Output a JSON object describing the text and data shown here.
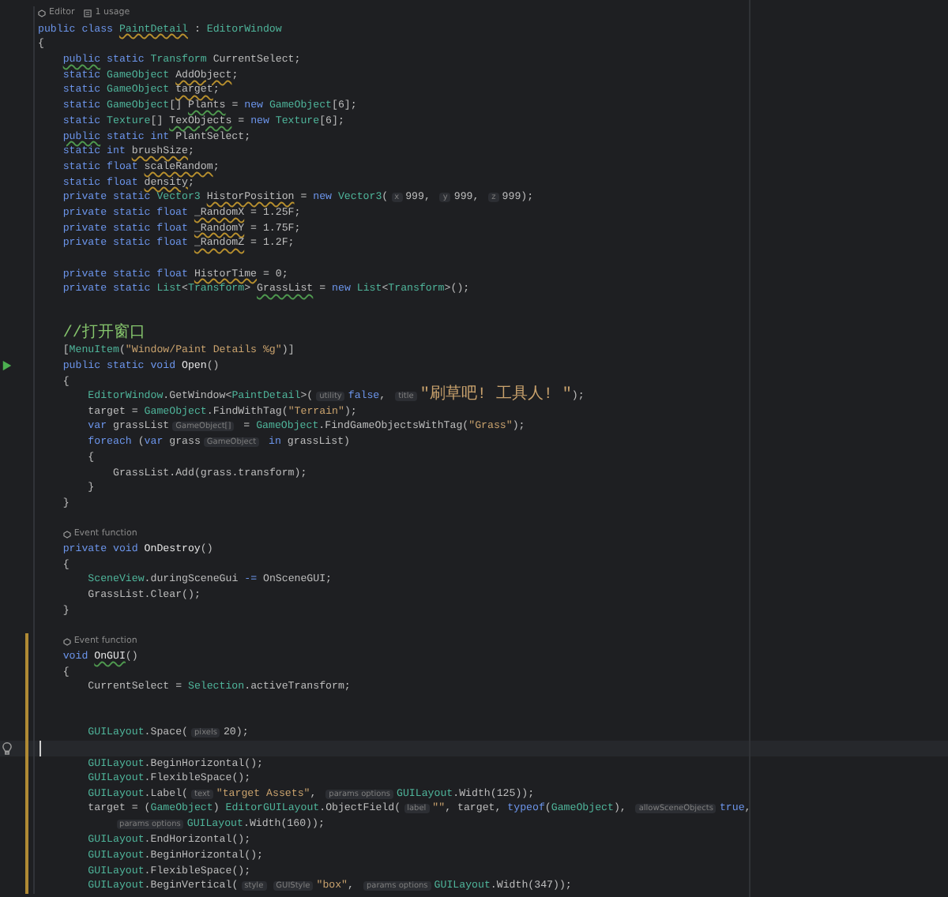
{
  "lines": [
    {
      "kind": "lens",
      "current": false,
      "modified": false,
      "items": [
        {
          "text": "Editor"
        },
        {
          "text": "1 usage"
        }
      ]
    },
    {
      "kind": "code",
      "current": false,
      "modified": false,
      "tokens": [
        {
          "kind": "kw",
          "text": "public class "
        },
        {
          "kind": "warntype",
          "text": "PaintDetail"
        },
        {
          "kind": "plain",
          "text": " : "
        },
        {
          "kind": "type",
          "text": "EditorWindow"
        }
      ]
    },
    {
      "kind": "code",
      "current": false,
      "modified": false,
      "tokens": [
        {
          "kind": "plain",
          "text": "{"
        }
      ],
      "children": [
        {
          "kind": "code",
          "current": false,
          "modified": false,
          "tokens": [
            {
              "kind": "suggkw",
              "text": "public"
            },
            {
              "kind": "kw",
              "text": " static "
            },
            {
              "kind": "type",
              "text": "Transform"
            },
            {
              "kind": "plain",
              "text": " CurrentSelect;"
            }
          ]
        },
        {
          "kind": "code",
          "current": false,
          "modified": false,
          "tokens": [
            {
              "kind": "kw",
              "text": "static "
            },
            {
              "kind": "type",
              "text": "GameObject "
            },
            {
              "kind": "warn",
              "text": "AddObject"
            },
            {
              "kind": "plain",
              "text": ";"
            }
          ]
        },
        {
          "kind": "code",
          "current": false,
          "modified": false,
          "tokens": [
            {
              "kind": "kw",
              "text": "static "
            },
            {
              "kind": "type",
              "text": "GameObject "
            },
            {
              "kind": "warn",
              "text": "target"
            },
            {
              "kind": "plain",
              "text": ";"
            }
          ]
        },
        {
          "kind": "code",
          "current": false,
          "modified": false,
          "tokens": [
            {
              "kind": "kw",
              "text": "static "
            },
            {
              "kind": "type",
              "text": "GameObject"
            },
            {
              "kind": "plain",
              "text": "[] "
            },
            {
              "kind": "sugg",
              "text": "Plants"
            },
            {
              "kind": "plain",
              "text": " = "
            },
            {
              "kind": "kw",
              "text": "new "
            },
            {
              "kind": "type",
              "text": "GameObject"
            },
            {
              "kind": "plain",
              "text": "[6];"
            }
          ]
        },
        {
          "kind": "code",
          "current": false,
          "modified": false,
          "tokens": [
            {
              "kind": "kw",
              "text": "static "
            },
            {
              "kind": "type",
              "text": "Texture"
            },
            {
              "kind": "plain",
              "text": "[] "
            },
            {
              "kind": "sugg",
              "text": "TexObjects"
            },
            {
              "kind": "plain",
              "text": " = "
            },
            {
              "kind": "kw",
              "text": "new "
            },
            {
              "kind": "type",
              "text": "Texture"
            },
            {
              "kind": "plain",
              "text": "[6];"
            }
          ]
        },
        {
          "kind": "code",
          "current": false,
          "modified": false,
          "tokens": [
            {
              "kind": "suggkw",
              "text": "public"
            },
            {
              "kind": "kw",
              "text": " static int "
            },
            {
              "kind": "plain",
              "text": "PlantSelect;"
            }
          ]
        },
        {
          "kind": "code",
          "current": false,
          "modified": false,
          "tokens": [
            {
              "kind": "kw",
              "text": "static int "
            },
            {
              "kind": "warn",
              "text": "brushSize"
            },
            {
              "kind": "plain",
              "text": ";"
            }
          ]
        },
        {
          "kind": "code",
          "current": false,
          "modified": false,
          "tokens": [
            {
              "kind": "kw",
              "text": "static float "
            },
            {
              "kind": "warn",
              "text": "scaleRandom"
            },
            {
              "kind": "plain",
              "text": ";"
            }
          ]
        },
        {
          "kind": "code",
          "current": false,
          "modified": false,
          "tokens": [
            {
              "kind": "kw",
              "text": "static float "
            },
            {
              "kind": "warn",
              "text": "density"
            },
            {
              "kind": "plain",
              "text": ";"
            }
          ]
        },
        {
          "kind": "code",
          "current": false,
          "modified": false,
          "tokens": [
            {
              "kind": "kw",
              "text": "private static "
            },
            {
              "kind": "type",
              "text": "Vector3 "
            },
            {
              "kind": "warn",
              "text": "HistorPosition"
            },
            {
              "kind": "plain",
              "text": " = "
            },
            {
              "kind": "kw",
              "text": "new "
            },
            {
              "kind": "type",
              "text": "Vector3"
            },
            {
              "kind": "plain",
              "text": "("
            },
            {
              "kind": "hint",
              "text": "x"
            },
            {
              "kind": "plain",
              "text": "999, "
            },
            {
              "kind": "hint",
              "text": "y"
            },
            {
              "kind": "plain",
              "text": "999, "
            },
            {
              "kind": "hint",
              "text": "z"
            },
            {
              "kind": "plain",
              "text": "999);"
            }
          ]
        },
        {
          "kind": "code",
          "current": false,
          "modified": false,
          "tokens": [
            {
              "kind": "kw",
              "text": "private static float "
            },
            {
              "kind": "warn",
              "text": "_RandomX"
            },
            {
              "kind": "plain",
              "text": " = 1.25F;"
            }
          ]
        },
        {
          "kind": "code",
          "current": false,
          "modified": false,
          "tokens": [
            {
              "kind": "kw",
              "text": "private static float "
            },
            {
              "kind": "warn",
              "text": "_RandomY"
            },
            {
              "kind": "plain",
              "text": " = 1.75F;"
            }
          ]
        },
        {
          "kind": "code",
          "current": false,
          "modified": false,
          "tokens": [
            {
              "kind": "kw",
              "text": "private static float "
            },
            {
              "kind": "warn",
              "text": "_RandomZ"
            },
            {
              "kind": "plain",
              "text": " = 1.2F;"
            }
          ]
        },
        {
          "kind": "blank",
          "current": false,
          "modified": false
        },
        {
          "kind": "code",
          "current": false,
          "modified": false,
          "tokens": [
            {
              "kind": "kw",
              "text": "private static float "
            },
            {
              "kind": "warn",
              "text": "HistorTime"
            },
            {
              "kind": "plain",
              "text": " = 0;"
            }
          ]
        },
        {
          "kind": "code",
          "current": false,
          "modified": false,
          "tokens": [
            {
              "kind": "kw",
              "text": "private static "
            },
            {
              "kind": "type",
              "text": "List"
            },
            {
              "kind": "plain",
              "text": "<"
            },
            {
              "kind": "type",
              "text": "Transform"
            },
            {
              "kind": "plain",
              "text": "> "
            },
            {
              "kind": "sugg",
              "text": "GrassList"
            },
            {
              "kind": "plain",
              "text": " = "
            },
            {
              "kind": "kw",
              "text": "new "
            },
            {
              "kind": "type",
              "text": "List"
            },
            {
              "kind": "plain",
              "text": "<"
            },
            {
              "kind": "type",
              "text": "Transform"
            },
            {
              "kind": "plain",
              "text": ">();"
            }
          ]
        },
        {
          "kind": "blank",
          "current": false,
          "modified": false
        },
        {
          "kind": "blank",
          "current": false,
          "modified": false
        },
        {
          "kind": "code",
          "current": false,
          "modified": false,
          "tokens": [
            {
              "kind": "comment",
              "text": "//打开窗口"
            }
          ]
        },
        {
          "kind": "code",
          "current": false,
          "modified": false,
          "tokens": [
            {
              "kind": "plain",
              "text": "["
            },
            {
              "kind": "type",
              "text": "MenuItem"
            },
            {
              "kind": "plain",
              "text": "("
            },
            {
              "kind": "str",
              "text": "\"Window/Paint Details %g\""
            },
            {
              "kind": "plain",
              "text": ")]"
            }
          ]
        },
        {
          "kind": "entrypoint",
          "current": false,
          "modified": false,
          "tokens": [
            {
              "kind": "kw",
              "text": "public static void "
            },
            {
              "kind": "fn",
              "text": "Open"
            },
            {
              "kind": "plain",
              "text": "()"
            }
          ]
        },
        {
          "kind": "code",
          "current": false,
          "modified": false,
          "tokens": [
            {
              "kind": "plain",
              "text": "{"
            }
          ],
          "children": [
            {
              "kind": "code",
              "current": false,
              "modified": false,
              "tokens": [
                {
                  "kind": "type",
                  "text": "EditorWindow"
                },
                {
                  "kind": "plain",
                  "text": ".GetWindow<"
                },
                {
                  "kind": "type",
                  "text": "PaintDetail"
                },
                {
                  "kind": "plain",
                  "text": ">("
                },
                {
                  "kind": "hint",
                  "text": "utility"
                },
                {
                  "kind": "kw",
                  "text": "false"
                },
                {
                  "kind": "plain",
                  "text": ", "
                },
                {
                  "kind": "hint",
                  "text": "title"
                },
                {
                  "kind": "str",
                  "text": "\"刷草吧! 工具人! \""
                },
                {
                  "kind": "plain",
                  "text": ");"
                }
              ]
            },
            {
              "kind": "code",
              "current": false,
              "modified": false,
              "tokens": [
                {
                  "kind": "plain",
                  "text": "target = "
                },
                {
                  "kind": "type",
                  "text": "GameObject"
                },
                {
                  "kind": "plain",
                  "text": ".FindWithTag("
                },
                {
                  "kind": "str",
                  "text": "\"Terrain\""
                },
                {
                  "kind": "plain",
                  "text": ");"
                }
              ]
            },
            {
              "kind": "code",
              "current": false,
              "modified": false,
              "tokens": [
                {
                  "kind": "kw",
                  "text": "var "
                },
                {
                  "kind": "plain",
                  "text": "grassList"
                },
                {
                  "kind": "hint",
                  "text": "GameObject[]"
                },
                {
                  "kind": "plain",
                  "text": " = "
                },
                {
                  "kind": "type",
                  "text": "GameObject"
                },
                {
                  "kind": "plain",
                  "text": ".FindGameObjectsWithTag("
                },
                {
                  "kind": "str",
                  "text": "\"Grass\""
                },
                {
                  "kind": "plain",
                  "text": ");"
                }
              ]
            },
            {
              "kind": "code",
              "current": false,
              "modified": false,
              "tokens": [
                {
                  "kind": "kw",
                  "text": "foreach "
                },
                {
                  "kind": "plain",
                  "text": "("
                },
                {
                  "kind": "kw",
                  "text": "var "
                },
                {
                  "kind": "plain",
                  "text": "grass"
                },
                {
                  "kind": "hint",
                  "text": "GameObject"
                },
                {
                  "kind": "kw",
                  "text": " in "
                },
                {
                  "kind": "plain",
                  "text": "grassList)"
                }
              ]
            },
            {
              "kind": "code",
              "current": false,
              "modified": false,
              "tokens": [
                {
                  "kind": "plain",
                  "text": "{"
                }
              ],
              "children": [
                {
                  "kind": "code",
                  "current": false,
                  "modified": false,
                  "tokens": [
                    {
                      "kind": "plain",
                      "text": "GrassList.Add(grass.transform);"
                    }
                  ]
                }
              ]
            },
            {
              "kind": "code",
              "current": false,
              "modified": false,
              "tokens": [
                {
                  "kind": "plain",
                  "text": "}"
                }
              ]
            }
          ]
        },
        {
          "kind": "code",
          "current": false,
          "modified": false,
          "tokens": [
            {
              "kind": "plain",
              "text": "}"
            }
          ]
        },
        {
          "kind": "blank",
          "current": false,
          "modified": false
        },
        {
          "kind": "lens",
          "current": false,
          "modified": false,
          "items": [
            {
              "text": "Event function"
            }
          ]
        },
        {
          "kind": "code",
          "current": false,
          "modified": false,
          "tokens": [
            {
              "kind": "kw",
              "text": "private void "
            },
            {
              "kind": "fn",
              "text": "OnDestroy"
            },
            {
              "kind": "plain",
              "text": "()"
            }
          ]
        },
        {
          "kind": "code",
          "current": false,
          "modified": false,
          "tokens": [
            {
              "kind": "plain",
              "text": "{"
            }
          ],
          "children": [
            {
              "kind": "code",
              "current": false,
              "modified": false,
              "tokens": [
                {
                  "kind": "type",
                  "text": "SceneView"
                },
                {
                  "kind": "plain",
                  "text": ".duringSceneGui "
                },
                {
                  "kind": "kw",
                  "text": "-="
                },
                {
                  "kind": "plain",
                  "text": " OnSceneGUI;"
                }
              ]
            },
            {
              "kind": "code",
              "current": false,
              "modified": false,
              "tokens": [
                {
                  "kind": "plain",
                  "text": "GrassList.Clear();"
                }
              ]
            }
          ]
        },
        {
          "kind": "code",
          "current": false,
          "modified": false,
          "tokens": [
            {
              "kind": "plain",
              "text": "}"
            }
          ]
        },
        {
          "kind": "blank",
          "current": false,
          "modified": false
        },
        {
          "kind": "lens",
          "current": false,
          "modified": true,
          "items": [
            {
              "text": "Event function"
            }
          ]
        },
        {
          "kind": "code",
          "current": false,
          "modified": true,
          "tokens": [
            {
              "kind": "kw",
              "text": "void "
            },
            {
              "kind": "suggfn",
              "text": "OnGUI"
            },
            {
              "kind": "plain",
              "text": "()"
            }
          ]
        },
        {
          "kind": "code",
          "current": false,
          "modified": true,
          "tokens": [
            {
              "kind": "plain",
              "text": "{"
            }
          ],
          "children": [
            {
              "kind": "code",
              "current": false,
              "modified": true,
              "tokens": [
                {
                  "kind": "plain",
                  "text": "CurrentSelect = "
                },
                {
                  "kind": "type",
                  "text": "Selection"
                },
                {
                  "kind": "plain",
                  "text": ".activeTransform;"
                }
              ]
            },
            {
              "kind": "blank",
              "current": false,
              "modified": true
            },
            {
              "kind": "blank",
              "current": false,
              "modified": true
            },
            {
              "kind": "code",
              "current": false,
              "modified": true,
              "tokens": [
                {
                  "kind": "type",
                  "text": "GUILayout"
                },
                {
                  "kind": "plain",
                  "text": ".Space("
                },
                {
                  "kind": "hint",
                  "text": "pixels"
                },
                {
                  "kind": "plain",
                  "text": "20);"
                }
              ]
            },
            {
              "kind": "blank",
              "current": true,
              "modified": true
            },
            {
              "kind": "code",
              "current": false,
              "modified": true,
              "tokens": [
                {
                  "kind": "type",
                  "text": "GUILayout"
                },
                {
                  "kind": "plain",
                  "text": ".BeginHorizontal();"
                }
              ]
            },
            {
              "kind": "code",
              "current": false,
              "modified": true,
              "tokens": [
                {
                  "kind": "type",
                  "text": "GUILayout"
                },
                {
                  "kind": "plain",
                  "text": ".FlexibleSpace();"
                }
              ]
            },
            {
              "kind": "code",
              "current": false,
              "modified": true,
              "tokens": [
                {
                  "kind": "type",
                  "text": "GUILayout"
                },
                {
                  "kind": "plain",
                  "text": ".Label("
                },
                {
                  "kind": "hint",
                  "text": "text"
                },
                {
                  "kind": "str",
                  "text": "\"target Assets\""
                },
                {
                  "kind": "plain",
                  "text": ", "
                },
                {
                  "kind": "hint",
                  "text": "params options"
                },
                {
                  "kind": "type",
                  "text": "GUILayout"
                },
                {
                  "kind": "plain",
                  "text": ".Width(125));"
                }
              ]
            },
            {
              "kind": "code",
              "current": false,
              "modified": true,
              "tokens": [
                {
                  "kind": "plain",
                  "text": "target = ("
                },
                {
                  "kind": "type",
                  "text": "GameObject"
                },
                {
                  "kind": "plain",
                  "text": ") "
                },
                {
                  "kind": "type",
                  "text": "EditorGUILayout"
                },
                {
                  "kind": "plain",
                  "text": ".ObjectField("
                },
                {
                  "kind": "hint",
                  "text": "label"
                },
                {
                  "kind": "str",
                  "text": "\"\""
                },
                {
                  "kind": "plain",
                  "text": ", target, "
                },
                {
                  "kind": "kw",
                  "text": "typeof"
                },
                {
                  "kind": "plain",
                  "text": "("
                },
                {
                  "kind": "type",
                  "text": "GameObject"
                },
                {
                  "kind": "plain",
                  "text": "), "
                },
                {
                  "kind": "hint",
                  "text": "allowSceneObjects"
                },
                {
                  "kind": "kw",
                  "text": "true"
                },
                {
                  "kind": "plain",
                  "text": ","
                }
              ],
              "children": [
                {
                  "kind": "code",
                  "current": false,
                  "modified": true,
                  "tokens": [
                    {
                      "kind": "hint",
                      "text": "params options"
                    },
                    {
                      "kind": "type",
                      "text": "GUILayout"
                    },
                    {
                      "kind": "plain",
                      "text": ".Width(160));"
                    }
                  ]
                }
              ]
            },
            {
              "kind": "code",
              "current": false,
              "modified": true,
              "tokens": [
                {
                  "kind": "type",
                  "text": "GUILayout"
                },
                {
                  "kind": "plain",
                  "text": ".EndHorizontal();"
                }
              ]
            },
            {
              "kind": "code",
              "current": false,
              "modified": true,
              "tokens": [
                {
                  "kind": "type",
                  "text": "GUILayout"
                },
                {
                  "kind": "plain",
                  "text": ".BeginHorizontal();"
                }
              ]
            },
            {
              "kind": "code",
              "current": false,
              "modified": true,
              "tokens": [
                {
                  "kind": "type",
                  "text": "GUILayout"
                },
                {
                  "kind": "plain",
                  "text": ".FlexibleSpace();"
                }
              ]
            },
            {
              "kind": "code",
              "current": false,
              "modified": true,
              "tokens": [
                {
                  "kind": "type",
                  "text": "GUILayout"
                },
                {
                  "kind": "plain",
                  "text": ".BeginVertical("
                },
                {
                  "kind": "hint",
                  "text": "style"
                },
                {
                  "kind": "hint",
                  "text": "GUIStyle"
                },
                {
                  "kind": "str",
                  "text": "\"box\""
                },
                {
                  "kind": "plain",
                  "text": ", "
                },
                {
                  "kind": "hint",
                  "text": "params options"
                },
                {
                  "kind": "type",
                  "text": "GUILayout"
                },
                {
                  "kind": "plain",
                  "text": ".Width(347));"
                }
              ]
            }
          ]
        }
      ]
    }
  ]
}
